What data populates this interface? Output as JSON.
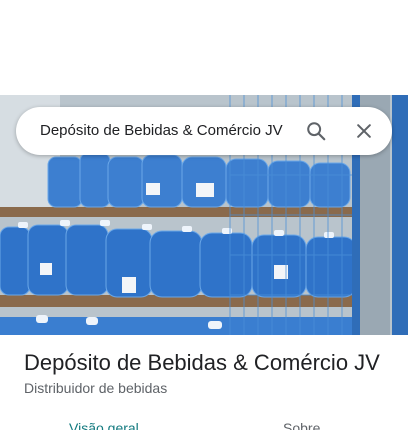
{
  "search": {
    "query": "Depósito de Bebidas & Comércio JV",
    "search_icon": "search-icon",
    "close_icon": "close-icon"
  },
  "place": {
    "title": "Depósito de Bebidas & Comércio JV",
    "category": "Distribuidor de bebidas"
  },
  "tabs": [
    {
      "label": "Visão geral",
      "active": true
    },
    {
      "label": "Sobre",
      "active": false
    }
  ],
  "colors": {
    "accent": "#137a7f",
    "title": "#202124",
    "secondary": "#5f6368"
  }
}
